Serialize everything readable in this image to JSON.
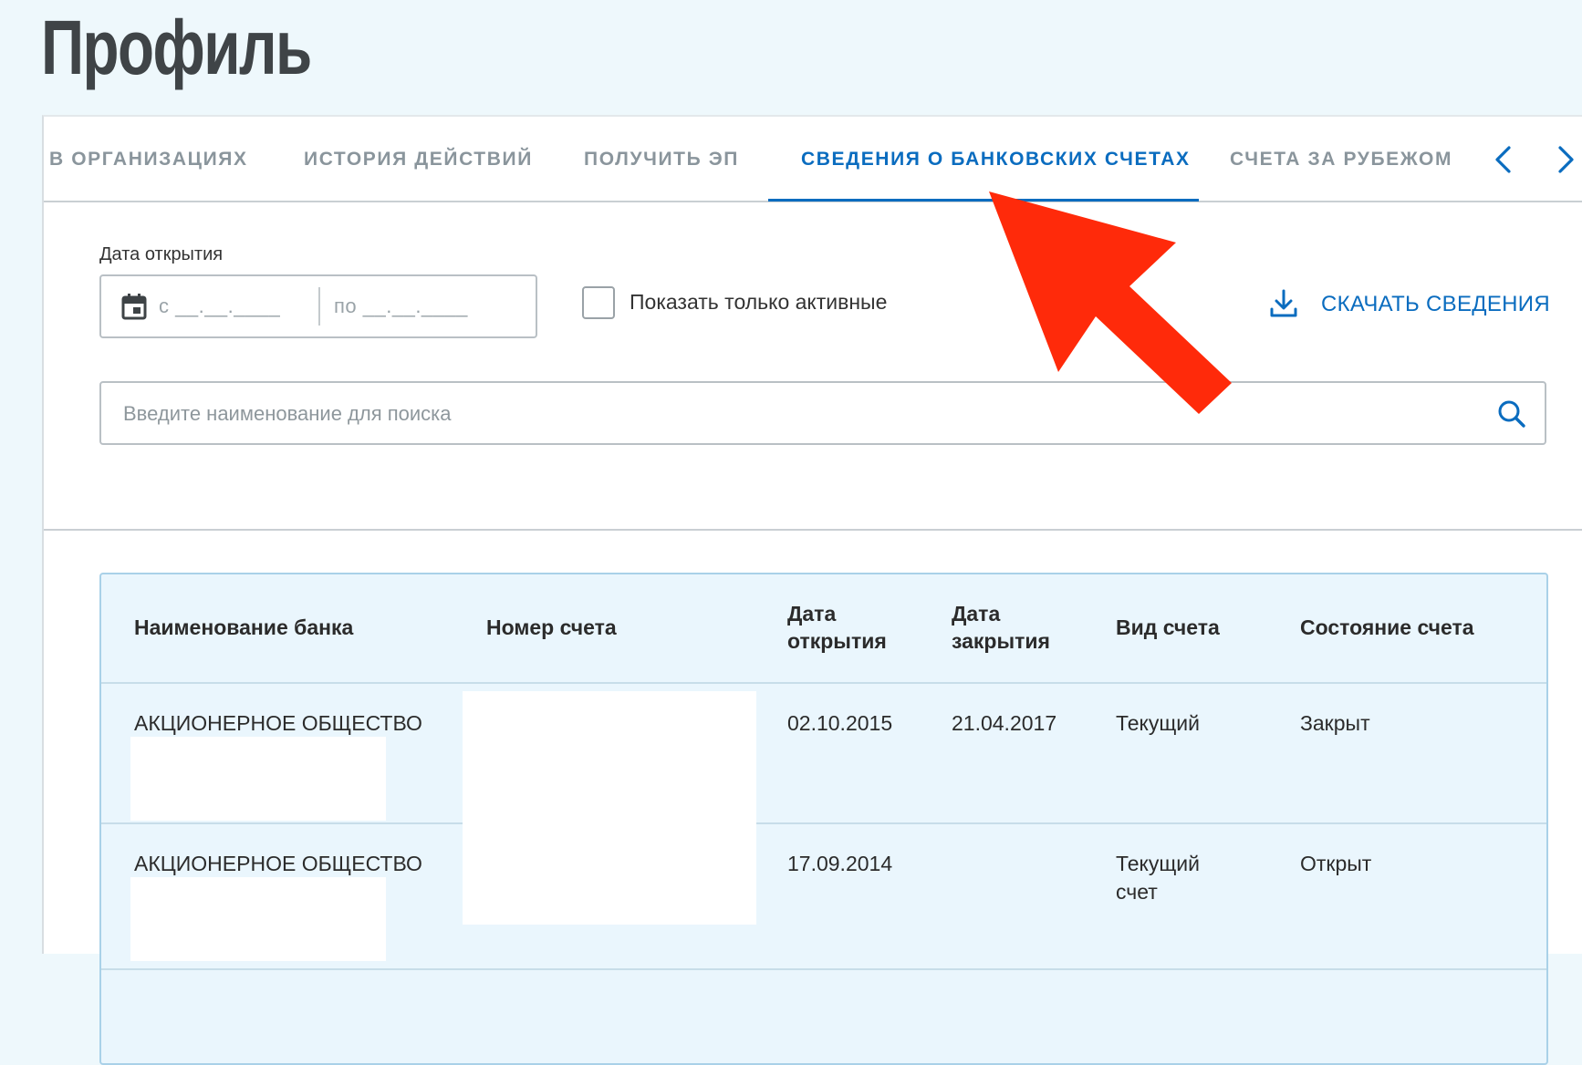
{
  "page": {
    "title": "Профиль"
  },
  "tabs": {
    "items": [
      {
        "label": "В ОРГАНИЗАЦИЯХ",
        "active": false
      },
      {
        "label": "ИСТОРИЯ ДЕЙСТВИЙ",
        "active": false
      },
      {
        "label": "ПОЛУЧИТЬ ЭП",
        "active": false
      },
      {
        "label": "СВЕДЕНИЯ О БАНКОВСКИХ СЧЕТАХ",
        "active": true
      },
      {
        "label": "СЧЕТА ЗА РУБЕЖОМ",
        "active": false
      }
    ],
    "prev_icon": "chevron-left-icon",
    "next_icon": "chevron-right-icon"
  },
  "filters": {
    "date_label": "Дата открытия",
    "date_from": "с __.__.____",
    "date_to": "по __.__.____",
    "calendar_icon": "calendar-icon",
    "active_only_label": "Показать только активные",
    "active_only_checked": false,
    "download_label": "СКАЧАТЬ СВЕДЕНИЯ",
    "download_icon": "download-icon",
    "search_placeholder": "Введите наименование для поиска",
    "search_value": "",
    "search_icon": "search-icon"
  },
  "table": {
    "headers": {
      "bank": "Наименование банка",
      "account": "Номер счета",
      "opened_line1": "Дата",
      "opened_line2": "открытия",
      "closed_line1": "Дата",
      "closed_line2": "закрытия",
      "type": "Вид счета",
      "status": "Состояние счета"
    },
    "rows": [
      {
        "bank": "АКЦИОНЕРНОЕ ОБЩЕСТВО",
        "account": "",
        "opened": "02.10.2015",
        "closed": "21.04.2017",
        "type_line1": "Текущий",
        "type_line2": "",
        "status": "Закрыт"
      },
      {
        "bank": "АКЦИОНЕРНОЕ ОБЩЕСТВО",
        "account": "",
        "opened": "17.09.2014",
        "closed": "",
        "type_line1": "Текущий",
        "type_line2": "счет",
        "status": "Открыт"
      }
    ]
  },
  "colors": {
    "page_background": "#eef8fc",
    "accent": "#0a6cbf",
    "tab_inactive": "#8a959c",
    "table_background": "#eaf6fd",
    "annotation_arrow": "#ff2a0a"
  }
}
